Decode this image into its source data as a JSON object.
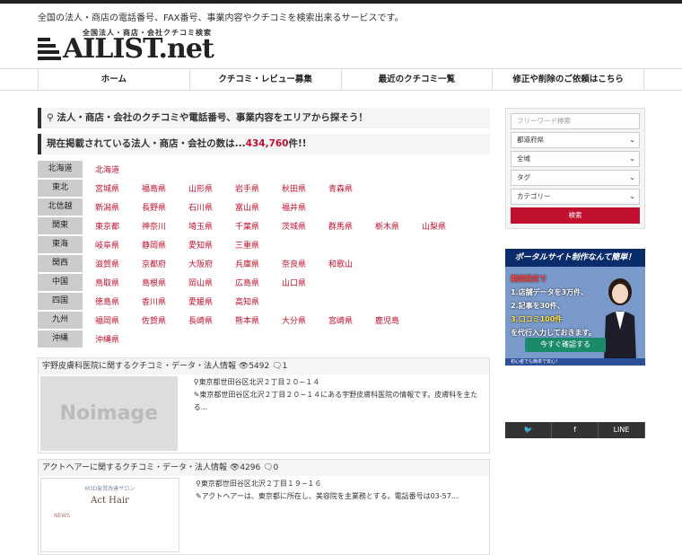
{
  "header": {
    "tagline": "全国の法人・商店の電話番号、FAX番号、事業内容やクチコミを検索出来るサービスです。",
    "logo_sub": "全国法人・商店・会社クチコミ検索",
    "logo_main": "AILIST.net"
  },
  "nav": [
    "ホーム",
    "クチコミ・レビュー募集",
    "最近のクチコミ一覧",
    "修正や削除のご依頼はこちら"
  ],
  "main": {
    "heading1": "法人・商店・会社のクチコミや電話番号、事業内容をエリアから探そう！",
    "heading2_prefix": "現在掲載されている法人・商店・会社の数は...",
    "heading2_count": "434,760",
    "heading2_suffix": "件!!",
    "regions": [
      {
        "name": "北海道",
        "prefs": [
          "北海道"
        ]
      },
      {
        "name": "東北",
        "prefs": [
          "宮城県",
          "福島県",
          "山形県",
          "岩手県",
          "秋田県",
          "青森県"
        ]
      },
      {
        "name": "北信越",
        "prefs": [
          "新潟県",
          "長野県",
          "石川県",
          "富山県",
          "福井県"
        ]
      },
      {
        "name": "関東",
        "prefs": [
          "東京都",
          "神奈川",
          "埼玉県",
          "千葉県",
          "茨城県",
          "群馬県",
          "栃木県",
          "山梨県"
        ]
      },
      {
        "name": "東海",
        "prefs": [
          "岐阜県",
          "静岡県",
          "愛知県",
          "三重県"
        ]
      },
      {
        "name": "関西",
        "prefs": [
          "滋賀県",
          "京都府",
          "大阪府",
          "兵庫県",
          "奈良県",
          "和歌山"
        ]
      },
      {
        "name": "中国",
        "prefs": [
          "鳥取県",
          "島根県",
          "岡山県",
          "広島県",
          "山口県"
        ]
      },
      {
        "name": "四国",
        "prefs": [
          "徳島県",
          "香川県",
          "愛媛県",
          "高知県"
        ]
      },
      {
        "name": "九州",
        "prefs": [
          "福岡県",
          "佐賀県",
          "長崎県",
          "熊本県",
          "大分県",
          "宮崎県",
          "鹿児島"
        ]
      },
      {
        "name": "沖縄",
        "prefs": [
          "沖縄県"
        ]
      }
    ],
    "cards": [
      {
        "title": "宇野皮膚科医院に関するクチコミ・データ・法人情報",
        "views": "5492",
        "comments": "1",
        "thumb_text": "Noimage",
        "address": "東京都世田谷区北沢２丁目２０−１４",
        "desc": "東京都世田谷区北沢２丁目２０−１４にある宇野皮膚科医院の情報です。皮膚科を主たる..."
      },
      {
        "title": "アクトヘアーに関するクチコミ・データ・法人情報",
        "views": "4296",
        "comments": "0",
        "thumb_text": "Act Hair",
        "thumb_caption": "M3D髪質改善サロン",
        "thumb_news": "NEWS",
        "address": "東京都世田谷区北沢２丁目１９−１６",
        "desc": "アクトヘアーは、東京都に所在し、美容院を主業務とする。電話番号は03-57..."
      }
    ]
  },
  "sidebar": {
    "search_placeholder": "フリーワード検索",
    "pref_select": "都道府県",
    "area_select": "全域",
    "tag_select": "タグ",
    "category_select": "カテゴリー",
    "search_button": "検索",
    "banner": {
      "title": "ポータルサイト制作なんて簡単！",
      "line1": "期間限定で",
      "line2": "1.店舗データを3万件、",
      "line3": "2.記事を30件、",
      "line4": "3.口コミ100件",
      "line5": "を代行入力しておきます。",
      "cta": "今すぐ確認する",
      "foot": "初心者でも簡単で安心！"
    }
  },
  "share": [
    "twitter-icon",
    "facebook-icon",
    "line-icon"
  ],
  "colors": {
    "accent": "#c0102d",
    "dark": "#333333"
  }
}
